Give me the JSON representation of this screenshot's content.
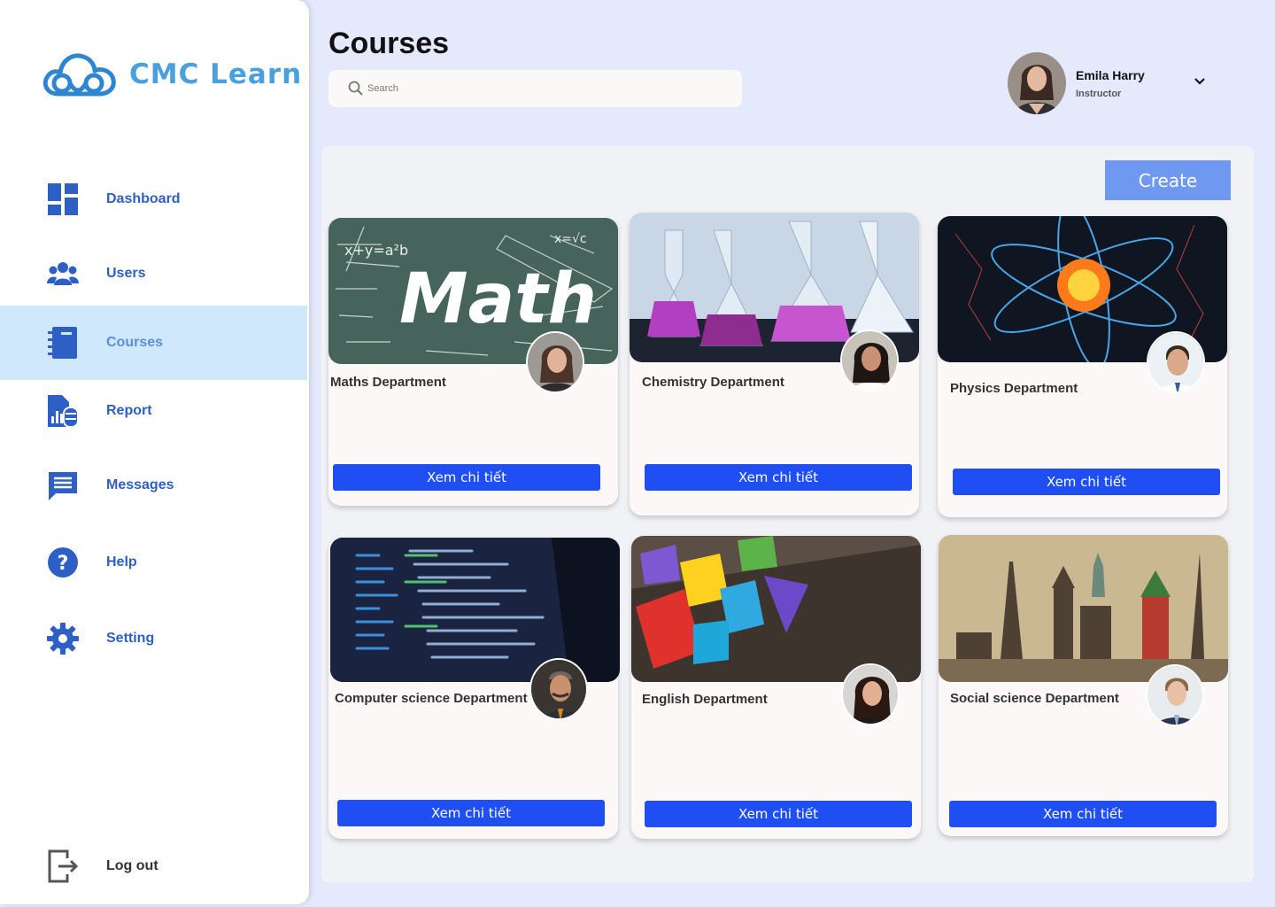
{
  "brand": {
    "name": "CMC Learn",
    "color": "#4aa0dc"
  },
  "sidebar": {
    "items": [
      {
        "label": "Dashboard",
        "icon": "dashboard-icon"
      },
      {
        "label": "Users",
        "icon": "users-icon"
      },
      {
        "label": "Courses",
        "icon": "notebook-icon",
        "active": true
      },
      {
        "label": "Report",
        "icon": "report-icon"
      },
      {
        "label": "Messages",
        "icon": "message-icon"
      },
      {
        "label": "Help",
        "icon": "help-icon"
      },
      {
        "label": "Setting",
        "icon": "gear-icon"
      }
    ],
    "logout": {
      "label": "Log out",
      "icon": "logout-icon"
    }
  },
  "header": {
    "title": "Courses",
    "search_placeholder": "Search",
    "user": {
      "name": "Emila Harry",
      "role": "Instructor"
    }
  },
  "actions": {
    "create_label": "Create"
  },
  "courses": [
    {
      "title": "Maths Department",
      "button": "Xem chi tiết",
      "image": "math-chalkboard"
    },
    {
      "title": "Chemistry Department",
      "button": "Xem chi tiết",
      "image": "chemistry-flasks"
    },
    {
      "title": "Physics Department",
      "button": "Xem chi tiết",
      "image": "physics-atom"
    },
    {
      "title": "Computer science Department",
      "button": "Xem chi tiết",
      "image": "code-screen"
    },
    {
      "title": "English Department",
      "button": "Xem chi tiết",
      "image": "alphabet-blocks"
    },
    {
      "title": "Social science Department",
      "button": "Xem chi tiết",
      "image": "world-landmarks"
    }
  ],
  "colors": {
    "accent": "#1f4ef2",
    "create": "#6f98f0",
    "nav_text": "#2d5fc4",
    "active_bg": "#cfe8fb"
  }
}
